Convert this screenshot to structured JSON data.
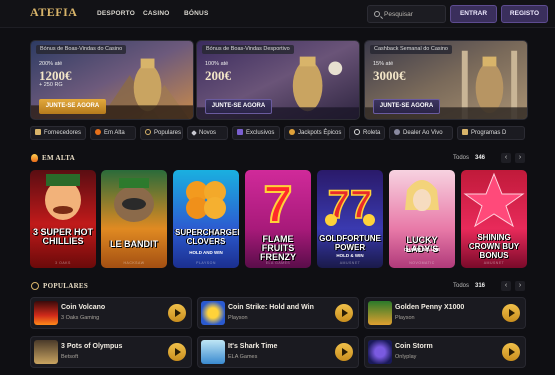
{
  "header": {
    "logo": "ATEFIA",
    "nav": [
      "DESPORTO",
      "CASINO",
      "BÓNUS"
    ],
    "search_placeholder": "Pesquisar",
    "login_label": "ENTRAR",
    "register_label": "REGISTO"
  },
  "banners": [
    {
      "title": "Bónus de Boas-Vindas do Casino",
      "pct": "200% até",
      "amount": "1200€",
      "extra": "+ 250 RG",
      "cta": "JUNTE-SE AGORA"
    },
    {
      "title": "Bónus de Boas-Vindas Desportivo",
      "pct": "100% até",
      "amount": "200€",
      "extra": "",
      "cta": "JUNTE-SE AGORA"
    },
    {
      "title": "Cashback Semanal do Casino",
      "pct": "15% até",
      "amount": "3000€",
      "extra": "",
      "cta": "JUNTE-SE AGORA"
    }
  ],
  "categories": [
    "Fornecedores",
    "Em Alta",
    "Populares",
    "Novos",
    "Exclusivos",
    "Jackpots Épicos",
    "Roleta",
    "Dealer Ao Vivo",
    "Programas D"
  ],
  "trending": {
    "title": "EM ALTA",
    "todos": "Todos",
    "count": "346",
    "games": [
      {
        "title": "3 Super Hot Chillies",
        "sub": "",
        "provider": "3 OAKS"
      },
      {
        "title": "Le Bandit",
        "sub": "",
        "provider": "HACKSAW"
      },
      {
        "title": "Supercharged Clovers",
        "sub": "HOLD AND WIN",
        "provider": "PLAYSON"
      },
      {
        "title": "Flame Fruits Frenzy",
        "sub": "",
        "provider": "ELA GAMES"
      },
      {
        "title": "Goldfortune Power",
        "sub": "HOLD & WIN",
        "provider": "AMUSNET"
      },
      {
        "title": "Lucky Lady's",
        "sub": "CHARM DELUXE",
        "provider": "NOVOMATIC"
      },
      {
        "title": "Shining Crown Buy Bonus",
        "sub": "",
        "provider": "AMUSNET"
      }
    ]
  },
  "popular": {
    "title": "POPULARES",
    "todos": "Todos",
    "count": "316",
    "games": [
      {
        "name": "Coin Volcano",
        "provider": "3 Oaks Gaming"
      },
      {
        "name": "Coin Strike: Hold and Win",
        "provider": "Playson"
      },
      {
        "name": "Golden Penny X1000",
        "provider": "Playson"
      },
      {
        "name": "3 Pots of Olympus",
        "provider": "Betsoft"
      },
      {
        "name": "It's Shark Time",
        "provider": "ELA Games"
      },
      {
        "name": "Coin Storm",
        "provider": "Onlyplay"
      }
    ]
  },
  "colors": {
    "background": "#0f0f13",
    "gold": "#d8b46a",
    "purple_button": "#3a2f5c",
    "cta_orange": "#e3a93c"
  }
}
